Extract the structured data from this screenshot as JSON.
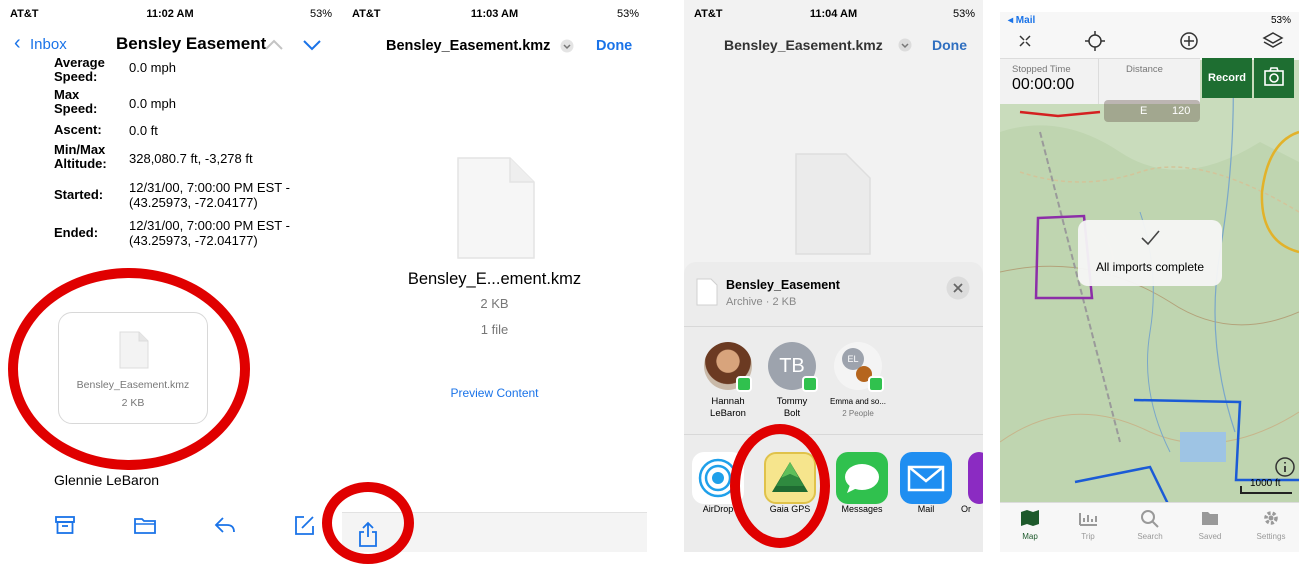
{
  "panel1": {
    "status": {
      "carrier": "AT&T",
      "time": "11:02 AM",
      "battery": "53%"
    },
    "nav": {
      "back_label": "Inbox",
      "title": "Bensley Easement"
    },
    "details": [
      {
        "label": "Average Speed:",
        "value": "0.0 mph"
      },
      {
        "label": "Max Speed:",
        "value": "0.0 mph"
      },
      {
        "label": "Ascent:",
        "value": "0.0 ft"
      },
      {
        "label": "Min/Max Altitude:",
        "value": "328,080.7 ft, -3,278 ft"
      },
      {
        "label": "Started:",
        "value": "12/31/00, 7:00:00 PM EST - (43.25973, -72.04177)"
      },
      {
        "label": "Ended:",
        "value": "12/31/00, 7:00:00 PM EST - (43.25973, -72.04177)"
      }
    ],
    "attachment": {
      "filename": "Bensley_Easement.kmz",
      "size": "2 KB"
    },
    "sender": "Glennie LeBaron"
  },
  "panel2": {
    "status": {
      "carrier": "AT&T",
      "time": "11:03 AM",
      "battery": "53%"
    },
    "title": "Bensley_Easement.kmz",
    "done_label": "Done",
    "file_name": "Bensley_E...ement.kmz",
    "file_size": "2 KB",
    "file_count": "1 file",
    "preview_label": "Preview Content"
  },
  "panel3": {
    "status": {
      "carrier": "AT&T",
      "time": "11:04 AM",
      "battery": "53%"
    },
    "title": "Bensley_Easement.kmz",
    "done_label": "Done",
    "share": {
      "name": "Bensley_Easement",
      "meta": "Archive · 2 KB",
      "contacts": [
        {
          "line1": "Hannah",
          "line2": "LeBaron",
          "initials": ""
        },
        {
          "line1": "Tommy",
          "line2": "Bolt",
          "initials": "TB"
        },
        {
          "line1": "Emma and so...",
          "line2": "2 People",
          "initials": "EL"
        }
      ],
      "apps": [
        {
          "label": "AirDrop"
        },
        {
          "label": "Gaia GPS"
        },
        {
          "label": "Messages"
        },
        {
          "label": "Mail"
        },
        {
          "label": "Or"
        }
      ]
    }
  },
  "panel4": {
    "status": {
      "back": "◂ Mail",
      "battery": "53%"
    },
    "stopped_time_label": "Stopped Time",
    "stopped_time_value": "00:00:00",
    "distance_label": "Distance",
    "record_label": "Record",
    "compass_left": "E",
    "compass_right": "120",
    "toast": "All imports complete",
    "scale": "1000 ft",
    "tabs": [
      "Map",
      "Trip",
      "Search",
      "Saved",
      "Settings"
    ]
  },
  "colors": {
    "ios_blue": "#1a73e8",
    "annotation_red": "#e00000",
    "gaia_green": "#1f6b32",
    "record_green": "#1e6e31"
  }
}
